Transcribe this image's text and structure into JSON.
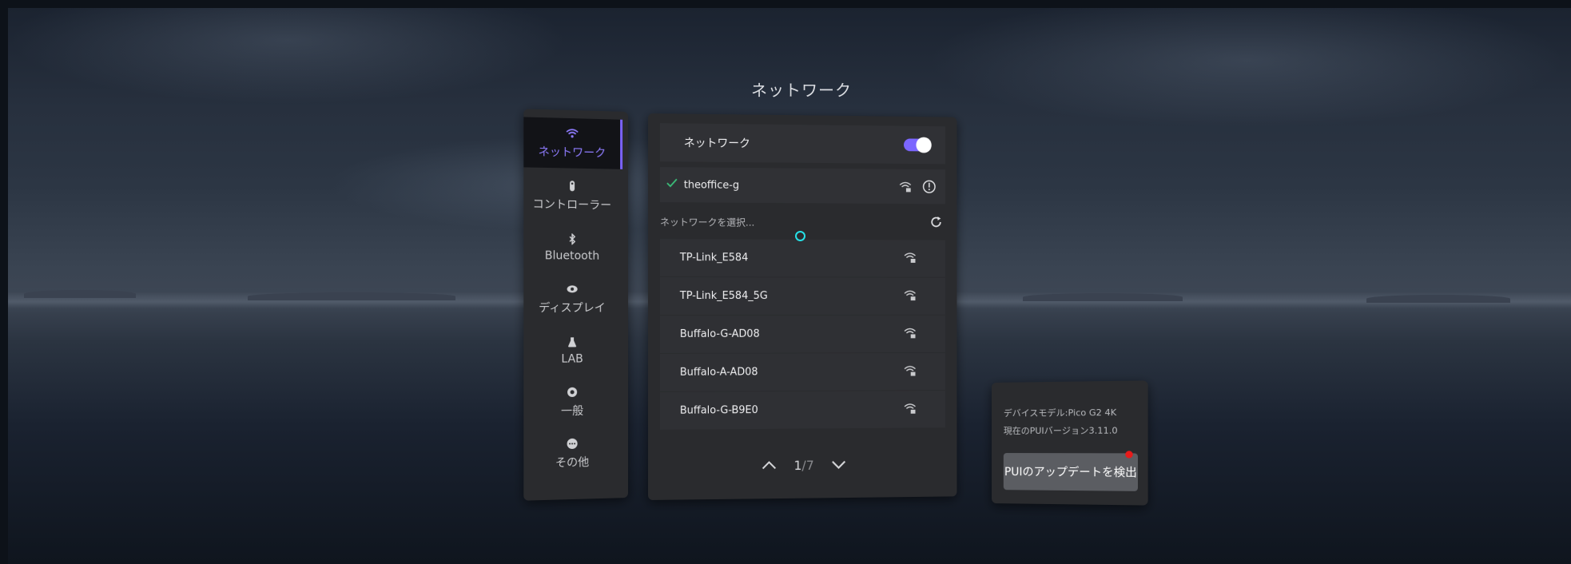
{
  "page_title": "ネットワーク",
  "sidebar": {
    "items": [
      {
        "label": "ネットワーク",
        "icon": "wifi-icon",
        "active": true
      },
      {
        "label": "コントローラー",
        "icon": "controller-icon",
        "active": false
      },
      {
        "label": "Bluetooth",
        "icon": "bluetooth-icon",
        "active": false
      },
      {
        "label": "ディスプレイ",
        "icon": "eye-icon",
        "active": false
      },
      {
        "label": "LAB",
        "icon": "flask-icon",
        "active": false
      },
      {
        "label": "一般",
        "icon": "gear-icon",
        "active": false
      },
      {
        "label": "その他",
        "icon": "more-icon",
        "active": false
      }
    ]
  },
  "network": {
    "toggle_label": "ネットワーク",
    "toggle_on": true,
    "connected": {
      "name": "theoffice-g",
      "icon": "check-icon"
    },
    "select_label": "ネットワークを選択...",
    "list": [
      {
        "name": "TP-Link_E584"
      },
      {
        "name": "TP-Link_E584_5G"
      },
      {
        "name": "Buffalo-G-AD08"
      },
      {
        "name": "Buffalo-A-AD08"
      },
      {
        "name": "Buffalo-G-B9E0"
      }
    ],
    "page_current": "1",
    "page_sep": "/",
    "page_total": "7"
  },
  "info": {
    "device_model": "デバイスモデル:Pico G2 4K",
    "pui_version": "現在のPUIバージョン3.11.0",
    "update_button": "PUIのアップデートを検出"
  },
  "colors": {
    "accent": "#7b66ff",
    "panel": "#2a2b2e",
    "row": "#303135",
    "check": "#3bbf7a",
    "cursor": "#26e0e6",
    "badge": "#e81a1a"
  }
}
